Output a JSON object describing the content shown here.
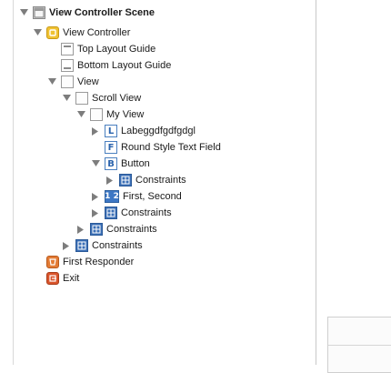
{
  "tree": {
    "scene": "View Controller Scene",
    "view_controller": "View Controller",
    "top_layout_guide": "Top Layout Guide",
    "bottom_layout_guide": "Bottom Layout Guide",
    "view": "View",
    "scroll_view": "Scroll View",
    "my_view": "My View",
    "label_item": "Labeggdfgdfgdgl",
    "text_field": "Round Style Text Field",
    "button": "Button",
    "button_constraints": "Constraints",
    "segmented": "First, Second",
    "my_view_constraints": "Constraints",
    "scroll_view_constraints": "Constraints",
    "view_constraints": "Constraints",
    "first_responder": "First Responder",
    "exit": "Exit"
  },
  "icons": {
    "label_letter": "L",
    "text_field_letter": "F",
    "button_letter": "B",
    "segmented_glyph": "1 2"
  },
  "colors": {
    "accent_blue": "#3b6fb6",
    "view_controller_yellow": "#e6b422",
    "first_responder_orange": "#e37b35",
    "exit_red": "#d9542b"
  }
}
